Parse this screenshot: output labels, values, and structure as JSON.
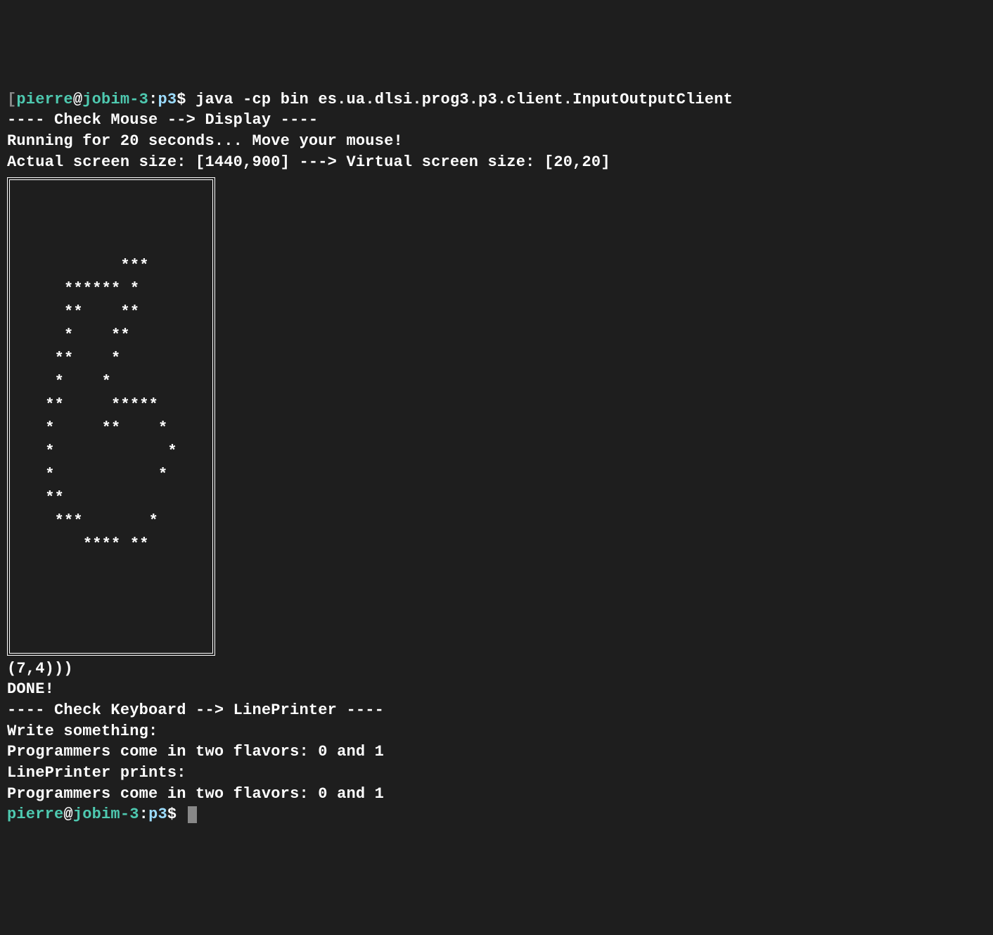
{
  "prompt1": {
    "bracket": "[",
    "user": "pierre",
    "at": "@",
    "host": "jobim-3",
    "colon": ":",
    "path": "p3",
    "dollar": "$ ",
    "command": "java -cp bin es.ua.dlsi.prog3.p3.client.InputOutputClient"
  },
  "lines": {
    "l1": "---- Check Mouse --> Display ----",
    "l2": "Running for 20 seconds... Move your mouse!",
    "l3": "Actual screen size: [1440,900] ---> Virtual screen size: [20,20]"
  },
  "ascii": {
    "r0": "                    ",
    "r1": "                    ",
    "r2": "                    ",
    "r3": "           ***      ",
    "r4": "     ****** *       ",
    "r5": "     **    **       ",
    "r6": "     *    **        ",
    "r7": "    **    *         ",
    "r8": "    *    *          ",
    "r9": "   **     *****     ",
    "r10": "   *     **    *    ",
    "r11": "   *            *   ",
    "r12": "   *           *    ",
    "r13": "   **               ",
    "r14": "    ***       *     ",
    "r15": "       **** **      ",
    "r16": "                    ",
    "r17": "                    ",
    "r18": "                    ",
    "r19": "                    "
  },
  "after": {
    "a1": "(7,4)))",
    "a2": "DONE!",
    "a3": "---- Check Keyboard --> LinePrinter ----",
    "a4": "Write something:",
    "a5": "Programmers come in two flavors: 0 and 1",
    "a6": "LinePrinter prints:",
    "a7": "Programmers come in two flavors: 0 and 1"
  },
  "prompt2": {
    "user": "pierre",
    "at": "@",
    "host": "jobim-3",
    "colon": ":",
    "path": "p3",
    "dollar": "$ "
  }
}
